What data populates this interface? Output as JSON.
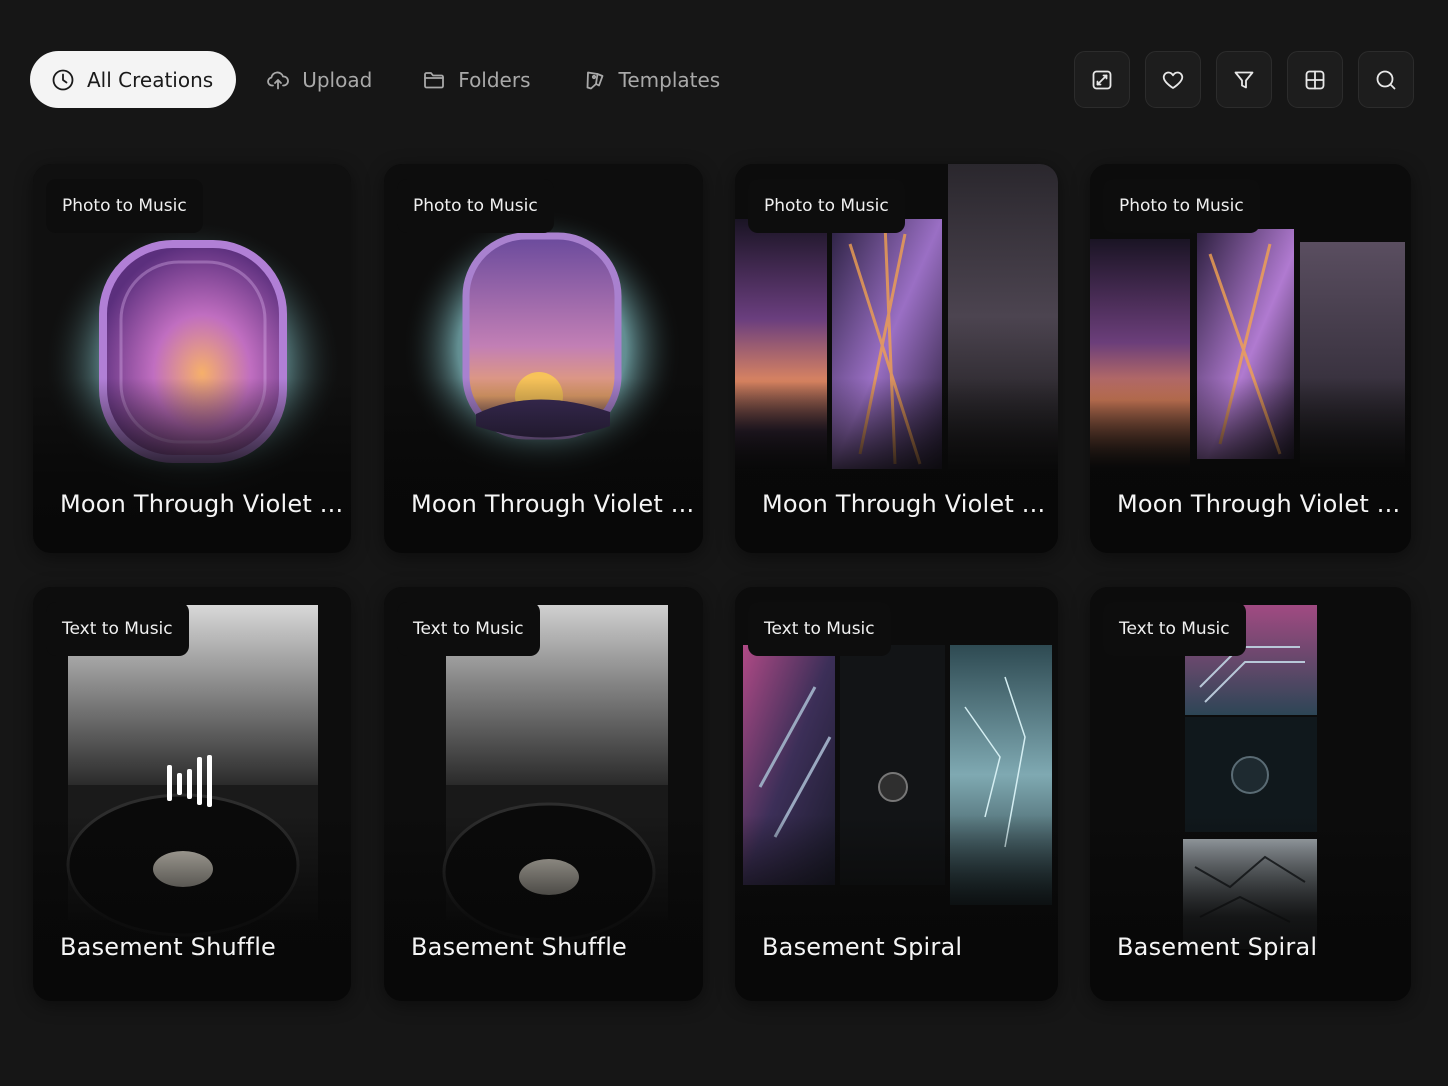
{
  "toolbar": {
    "tabs": [
      {
        "label": "All Creations",
        "icon": "clock-icon",
        "active": true
      },
      {
        "label": "Upload",
        "icon": "cloud-upload-icon",
        "active": false
      },
      {
        "label": "Folders",
        "icon": "folder-icon",
        "active": false
      },
      {
        "label": "Templates",
        "icon": "template-icon",
        "active": false
      }
    ],
    "icon_buttons": [
      "expand-icon",
      "heart-icon",
      "filter-icon",
      "grid-view-icon",
      "search-icon"
    ]
  },
  "cards": [
    {
      "badge": "Photo to Music",
      "title": "Moon Through Violet ..."
    },
    {
      "badge": "Photo to Music",
      "title": "Moon Through Violet ..."
    },
    {
      "badge": "Photo to Music",
      "title": "Moon Through Violet ..."
    },
    {
      "badge": "Photo to Music",
      "title": "Moon Through Violet ..."
    },
    {
      "badge": "Text to Music",
      "title": "Basement Shuffle"
    },
    {
      "badge": "Text to Music",
      "title": "Basement Shuffle"
    },
    {
      "badge": "Text to Music",
      "title": "Basement Spiral"
    },
    {
      "badge": "Text to Music",
      "title": "Basement Spiral"
    }
  ],
  "colors": {
    "background": "#161616",
    "card": "#0b0b0b",
    "active_tab": "#f4f4f4",
    "accent_violet": "#a679d6",
    "accent_teal": "#8fd3d8"
  }
}
